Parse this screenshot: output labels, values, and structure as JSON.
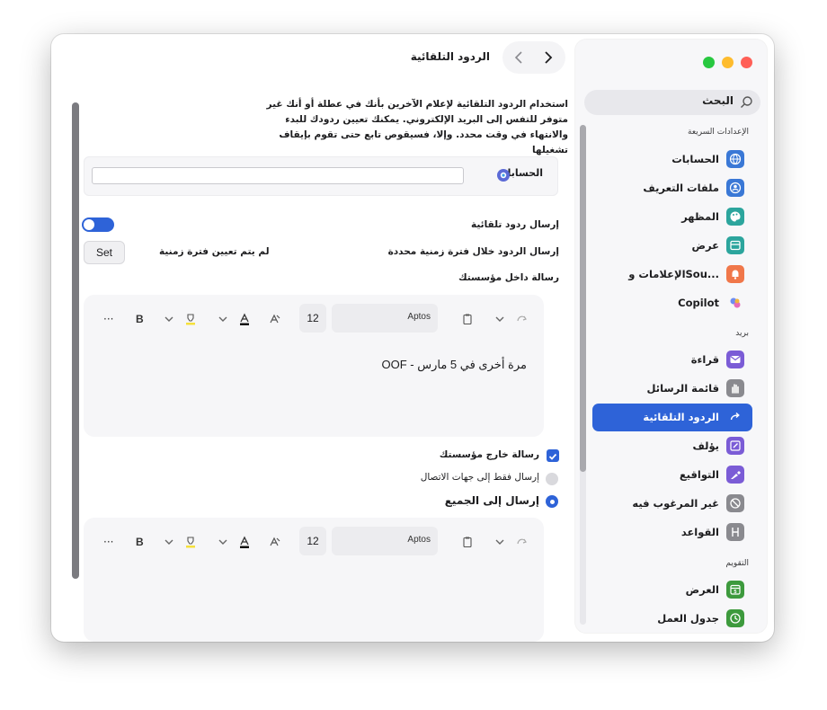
{
  "window": {
    "title": "الردود التلقائية"
  },
  "traffic_lights": {
    "close": "#ff5f57",
    "minimize": "#febc2e",
    "zoom": "#28c840"
  },
  "sidebar": {
    "search_label": "البحث",
    "quick_settings_header": "الإعدادات السريعة",
    "quick_items": [
      {
        "label": "الحسابات",
        "icon": "globe-icon",
        "color": "#3a78d6"
      },
      {
        "label": "ملفات التعريف",
        "icon": "profile-icon",
        "color": "#3a78d6"
      },
      {
        "label": "المظهر",
        "icon": "palette-icon",
        "color": "#2ca59d"
      },
      {
        "label": "عرض",
        "icon": "display-icon",
        "color": "#2ca59d"
      },
      {
        "label": "الإعلامات وSou...",
        "icon": "bell-icon",
        "color": "#f0774a"
      },
      {
        "label": "Copilot",
        "icon": "copilot-icon",
        "color": "#8a5cf6"
      }
    ],
    "mail_header": "بريد",
    "mail_items": [
      {
        "label": "قراءة",
        "icon": "envelope-icon",
        "color": "#7b5cd6"
      },
      {
        "label": "قائمة الرسائل",
        "icon": "hand-icon",
        "color": "#8a8a8f"
      },
      {
        "label": "الردود التلقائية",
        "icon": "reply-arrow-icon",
        "color": "#2e63d8",
        "active": true
      },
      {
        "label": "يؤلف",
        "icon": "compose-icon",
        "color": "#7b5cd6"
      },
      {
        "label": "التواقيع",
        "icon": "signature-icon",
        "color": "#7b5cd6"
      },
      {
        "label": "غير المرغوب فيه",
        "icon": "junk-icon",
        "color": "#8a8a8f"
      },
      {
        "label": "القواعد",
        "icon": "rules-icon",
        "color": "#8a8a8f"
      }
    ],
    "calendar_header": "التقويم",
    "calendar_items": [
      {
        "label": "العرض",
        "icon": "calendar-icon",
        "color": "#3d9a3d"
      },
      {
        "label": "جدول العمل",
        "icon": "clock-icon",
        "color": "#3d9a3d"
      }
    ]
  },
  "main": {
    "description": "استخدام الردود التلقائية لإعلام الآخرين بأنك في عطلة أو أنك غير متوفر للتفس إلى البريد الإلكتروني. يمكنك تعيين ردودك للبدء والانتهاء في وقت محدد. وإلا، فسيقوص تابع حتى تقوم بإيقاف تشغيلها",
    "accounts_label": "الحسابات",
    "send_auto_replies_label": "إرسال ردود تلقائية",
    "send_during_period_label": "إرسال الردود خلال فترة زمنية محددة",
    "no_period_text": "لم يتم تعيين فترة زمنية",
    "set_button": "Set",
    "inside_org_label": "رسالة داخل مؤسستك",
    "editor": {
      "font": "Aptos",
      "size": "12",
      "more": "···",
      "bold": "B"
    },
    "inside_message": "OOF - مرة أخرى في 5 مارس",
    "outside_org_label": "رسالة خارج مؤسستك",
    "contacts_only_label": "إرسال فقط إلى جهات الاتصال",
    "everyone_label": "إرسال إلى الجميع",
    "accent": "#2e63d8"
  }
}
